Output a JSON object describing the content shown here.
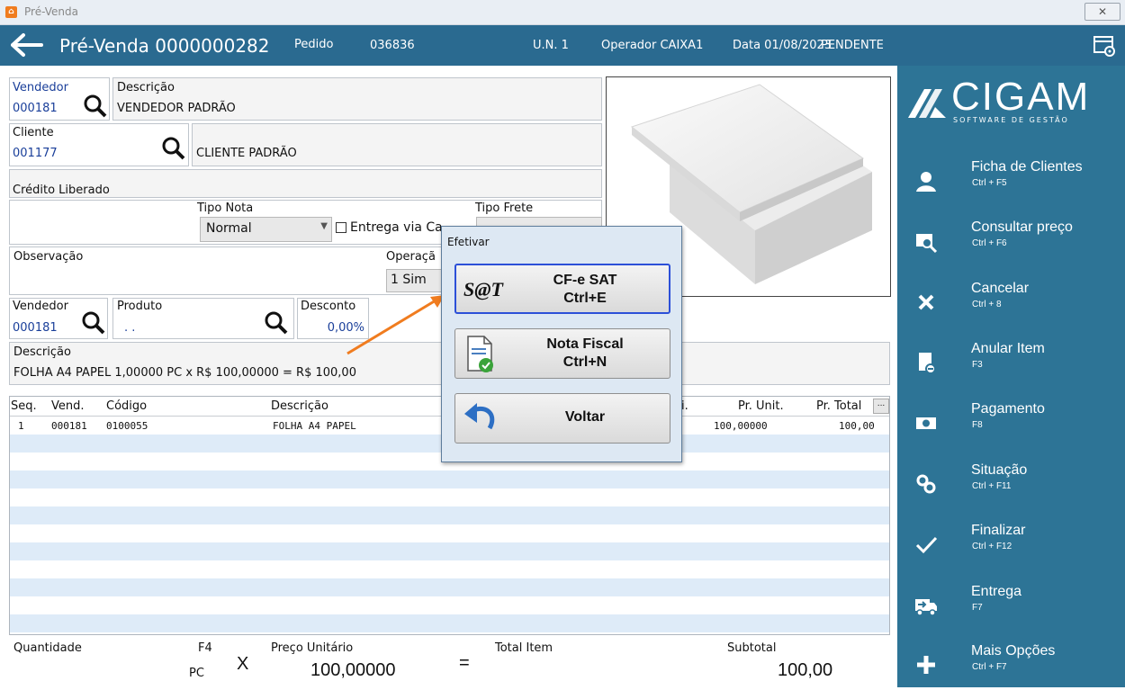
{
  "window": {
    "title": "Pré-Venda",
    "close_symbol": "✕"
  },
  "header": {
    "title": "Pré-Venda 0000000282",
    "pedido_label": "Pedido",
    "pedido_value": "036836",
    "un": "U.N. 1",
    "operador": "Operador CAIXA1",
    "data": "Data 01/08/2023",
    "status": "PENDENTE"
  },
  "form": {
    "vendedor_label": "Vendedor",
    "vendedor_code": "000181",
    "descricao_label": "Descrição",
    "vendedor_name": "VENDEDOR PADRÃO",
    "cliente_label": "Cliente",
    "cliente_code": "001177",
    "cliente_name": "CLIENTE PADRÃO",
    "credito": "Crédito Liberado",
    "tipo_nota_label": "Tipo Nota",
    "tipo_nota_value": "Normal",
    "entrega_label": "Entrega via Ca",
    "tipo_frete_label": "Tipo Frete",
    "observacao_label": "Observação",
    "operacao_label": "Operaçã",
    "operacao_value": "1 Sim",
    "vendedor2_label": "Vendedor",
    "vendedor2_code": "000181",
    "produto_label": "Produto",
    "produto_value": ". .",
    "desconto_label": "Desconto",
    "desconto_value": "0,00%",
    "descricao2_label": "Descrição",
    "descricao2_value": "FOLHA A4 PAPEL 1,00000 PC x R$ 100,00000 = R$ 100,00"
  },
  "grid": {
    "headers": {
      "seq": "Seq.",
      "vend": "Vend.",
      "codigo": "Código",
      "descricao": "Descrição",
      "i": "i.",
      "pr_unit": "Pr. Unit.",
      "pr_total": "Pr. Total",
      "more": "..."
    },
    "rows": [
      {
        "seq": "1",
        "vend": "000181",
        "codigo": "0100055",
        "descricao": "FOLHA A4 PAPEL",
        "pr_unit": "100,00000",
        "pr_total": "100,00"
      }
    ]
  },
  "footer": {
    "quantidade_label": "Quantidade",
    "f4": "F4",
    "unit": "PC",
    "x": "X",
    "preco_label": "Preço Unitário",
    "preco_value": "100,00000",
    "eq": "=",
    "total_item_label": "Total Item",
    "subtotal_label": "Subtotal",
    "subtotal_value": "100,00"
  },
  "dialog": {
    "title": "Efetivar",
    "buttons": [
      {
        "label": "CF-e SAT",
        "shortcut": "Ctrl+E",
        "icon_text": "S@T"
      },
      {
        "label": "Nota Fiscal",
        "shortcut": "Ctrl+N"
      },
      {
        "label": "Voltar"
      }
    ]
  },
  "sidebar": {
    "logo_text": "CIGAM",
    "logo_sub": "SOFTWARE DE GESTÃO",
    "items": [
      {
        "label": "Ficha de Clientes",
        "key": "Ctrl + F5",
        "icon": "user-icon"
      },
      {
        "label": "Consultar preço",
        "key": "Ctrl + F6",
        "icon": "price-search-icon"
      },
      {
        "label": "Cancelar",
        "key": "Ctrl + 8",
        "icon": "close-icon"
      },
      {
        "label": "Anular Item",
        "key": "F3",
        "icon": "void-item-icon"
      },
      {
        "label": "Pagamento",
        "key": "F8",
        "icon": "money-icon"
      },
      {
        "label": "Situação",
        "key": "Ctrl + F11",
        "icon": "status-icon"
      },
      {
        "label": "Finalizar",
        "key": "Ctrl + F12",
        "icon": "check-icon"
      },
      {
        "label": "Entrega",
        "key": "F7",
        "icon": "delivery-truck-icon"
      },
      {
        "label": "Mais Opções",
        "key": "Ctrl + F7",
        "icon": "plus-icon"
      }
    ]
  },
  "colors": {
    "header": "#2a6a90",
    "sidebar": "#2d7496",
    "arrow": "#f07c1f",
    "focus": "#2c50d8"
  }
}
